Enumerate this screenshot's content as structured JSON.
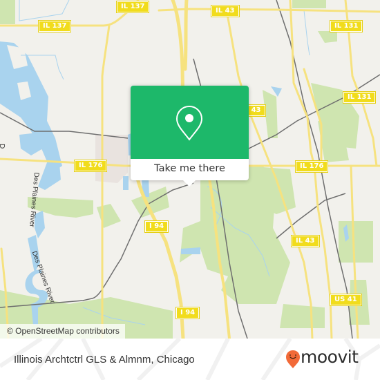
{
  "map": {
    "colors": {
      "background": "#f2f1ec",
      "water": "#a9d3ee",
      "park": "#cfe5b0",
      "road_major": "#f6e27f",
      "road_shield": "#f1dc1c",
      "rail": "#6e6e6e",
      "urban": "#e9e3df"
    },
    "route_shields": [
      {
        "id": "il137-west",
        "label": "IL 137"
      },
      {
        "id": "il137-north",
        "label": "IL 137"
      },
      {
        "id": "il43-north",
        "label": "IL 43"
      },
      {
        "id": "il131-north",
        "label": "IL 131"
      },
      {
        "id": "il131-east",
        "label": "IL 131"
      },
      {
        "id": "il43-mid",
        "label": "IL 43"
      },
      {
        "id": "il176-west",
        "label": "IL 176"
      },
      {
        "id": "il176-east",
        "label": "IL 176"
      },
      {
        "id": "i94-mid",
        "label": "I 94"
      },
      {
        "id": "il43-south",
        "label": "IL 43"
      },
      {
        "id": "i94-south",
        "label": "I 94"
      },
      {
        "id": "us41",
        "label": "US 41"
      }
    ],
    "water_labels": [
      "Des Plaines River",
      "Des Plaines River"
    ],
    "edge_label_partial": "D",
    "attribution": "© OpenStreetMap contributors"
  },
  "popup": {
    "icon": "map-pin-icon",
    "action_label": "Take me there",
    "accent": "#1db86a"
  },
  "footer": {
    "place_name": "Illinois Archtctrl GLS & Almnm, Chicago",
    "brand": {
      "name": "moovit",
      "logo_icon": "moovit-pin-smile-icon",
      "logo_color": "#f26a38"
    }
  }
}
